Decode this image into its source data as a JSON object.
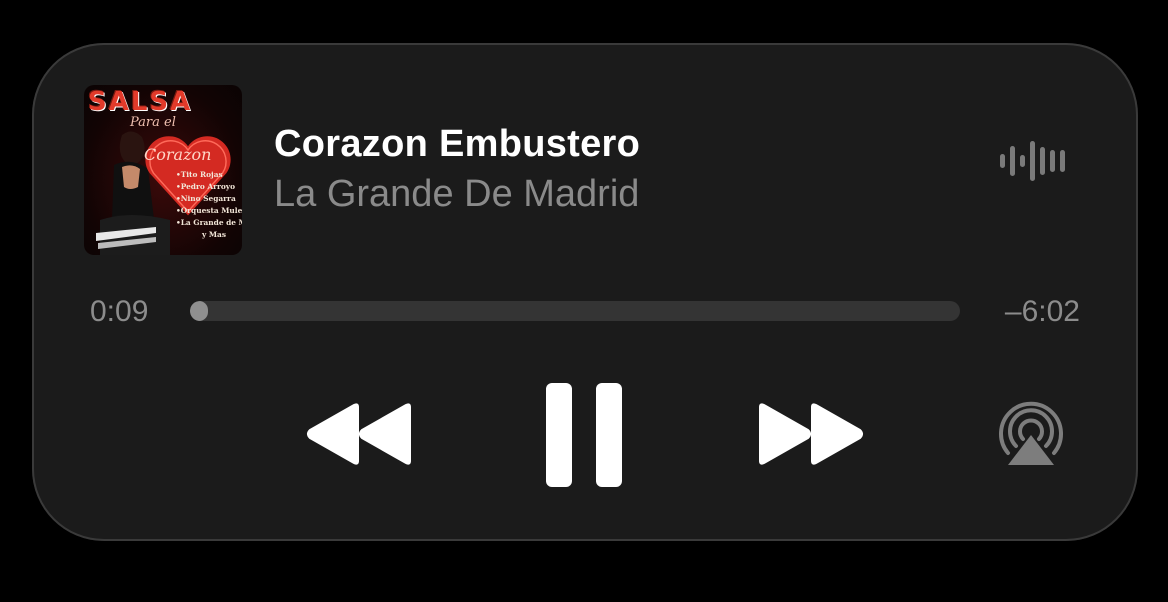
{
  "album_art": {
    "title": "SALSA",
    "subtitle": "Para el",
    "heart_text": "Corazon",
    "artists": [
      "•Tito Rojas",
      "•Pedro Arroyo",
      "•Nino Segarra",
      "•Orquesta Mulenze",
      "•La Grande de Madrid",
      "y Mas"
    ]
  },
  "track": {
    "title": "Corazon Embustero",
    "artist": "La Grande De Madrid"
  },
  "playback": {
    "elapsed": "0:09",
    "remaining": "–6:02",
    "progress_fraction": 0.024
  },
  "icons": {
    "waveform": "waveform-icon",
    "rewind": "rewind-icon",
    "pause": "pause-icon",
    "forward": "fast-forward-icon",
    "airplay": "airplay-audio-icon"
  },
  "colors": {
    "background": "#000000",
    "panel": "#1b1b1b",
    "title": "#ffffff",
    "secondary": "#8a8a8a",
    "track_empty": "#343434",
    "track_fill": "#8f8f8f"
  }
}
